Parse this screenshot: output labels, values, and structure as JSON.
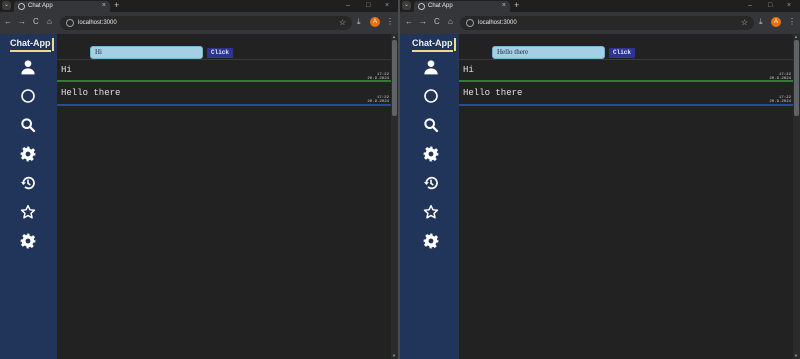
{
  "browser": {
    "tab_menu_icon": "chevron-down-icon",
    "tab_title": "Chat App",
    "tab_close": "×",
    "new_tab": "+",
    "minimize": "–",
    "maximize": "□",
    "close": "×",
    "back": "←",
    "forward": "→",
    "reload": "C",
    "home": "⌂",
    "url": "localhost:3000",
    "bookmark_star": "☆",
    "download": "⤓",
    "profile_initial": "A",
    "menu": "⋮"
  },
  "app": {
    "brand": "Chat-App",
    "nav_icons": [
      "person-icon",
      "circle-icon",
      "search-icon",
      "settings-icon",
      "history-icon",
      "star-icon",
      "settings-icon"
    ],
    "button_label": "Click"
  },
  "windows": [
    {
      "input_value": "Hi",
      "messages": [
        {
          "text": "Hi",
          "time": "17:22",
          "date": "20.9.2024"
        },
        {
          "text": "Hello there",
          "time": "17:22",
          "date": "20.9.2024"
        }
      ]
    },
    {
      "input_value": "Hello there",
      "messages": [
        {
          "text": "Hi",
          "time": "17:22",
          "date": "20.9.2024"
        },
        {
          "text": "Hello there",
          "time": "17:22",
          "date": "20.9.2024"
        }
      ]
    }
  ],
  "colors": {
    "sidebar": "#21355a",
    "brand_underline": "#f1d690",
    "input_bg": "#a4cfe5",
    "button_bg": "#2e3590",
    "message_border_1": "#2e7d32",
    "message_border_2": "#1f4f9c"
  }
}
